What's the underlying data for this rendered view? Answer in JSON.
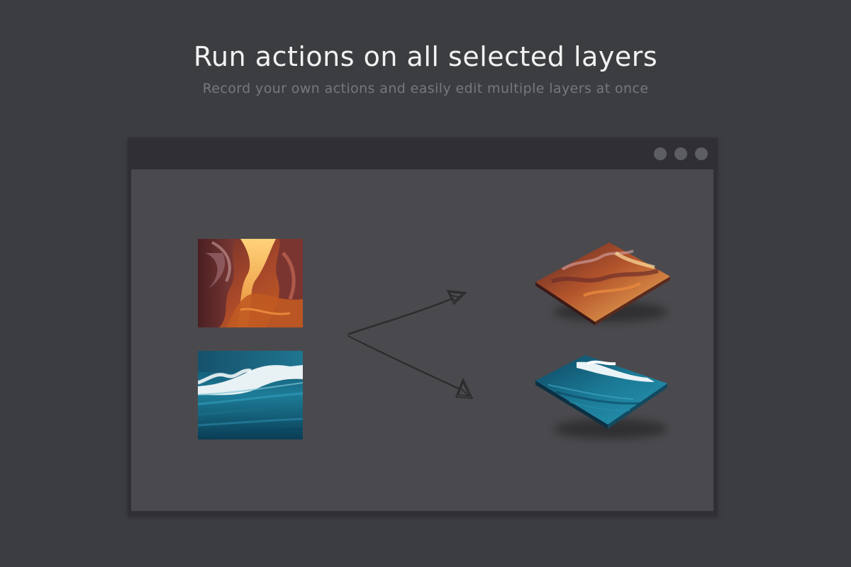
{
  "hero": {
    "title": "Run actions on all selected layers",
    "subtitle": "Record your own actions and easily edit multiple layers at once"
  },
  "window": {
    "controls": [
      "window-dot",
      "window-dot",
      "window-dot"
    ]
  },
  "layers": [
    {
      "name": "canyon",
      "icon": "canyon-image"
    },
    {
      "name": "wave",
      "icon": "wave-image"
    }
  ],
  "colors": {
    "background": "#3c3d41",
    "window_frame": "#303034",
    "canvas": "#4a4a4e",
    "title_text": "#f2f2f2",
    "subtitle_text": "#77787c",
    "window_dot": "#5d5e63",
    "arrow_stroke": "#2a2a2c"
  }
}
